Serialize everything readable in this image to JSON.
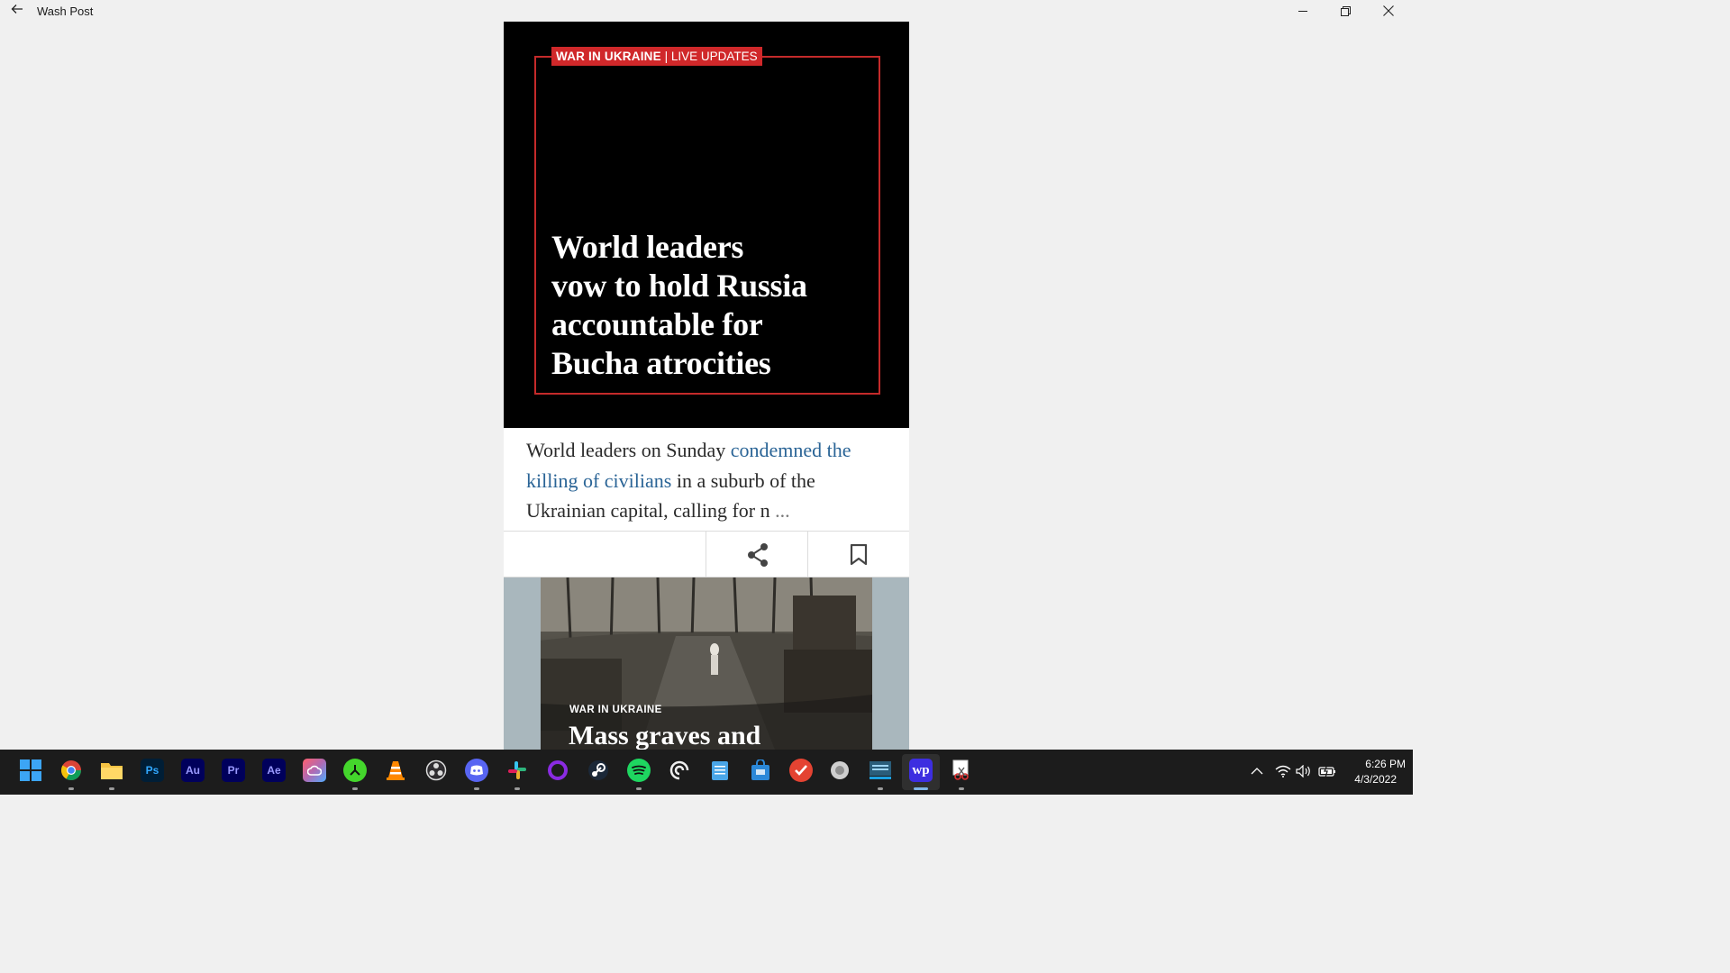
{
  "window": {
    "title": "Wash Post"
  },
  "hero": {
    "kicker_section": "WAR IN UKRAINE",
    "kicker_separator": "|",
    "kicker_label": "LIVE UPDATES",
    "headline_lines": [
      "World leaders",
      "vow to hold Russia",
      "accountable for",
      "Bucha atrocities"
    ]
  },
  "summary": {
    "text_before": "World leaders on Sunday ",
    "link_text": "condemned the killing of civilians",
    "text_after": " in a suburb of the Ukrainian capital, calling for n",
    "ellipsis": "..."
  },
  "next_story": {
    "kicker": "WAR IN UKRAINE",
    "headline": "Mass graves and"
  },
  "taskbar": {
    "apps": [
      {
        "name": "start-icon"
      },
      {
        "name": "chrome-icon"
      },
      {
        "name": "file-explorer-icon"
      },
      {
        "name": "photoshop-icon",
        "label": "Ps"
      },
      {
        "name": "audition-icon",
        "label": "Au"
      },
      {
        "name": "premiere-icon",
        "label": "Pr"
      },
      {
        "name": "after-effects-icon",
        "label": "Ae"
      },
      {
        "name": "creative-cloud-icon"
      },
      {
        "name": "razer-icon"
      },
      {
        "name": "vlc-icon"
      },
      {
        "name": "obs-icon"
      },
      {
        "name": "discord-icon"
      },
      {
        "name": "slack-icon"
      },
      {
        "name": "cortana-icon"
      },
      {
        "name": "steam-icon"
      },
      {
        "name": "spotify-icon"
      },
      {
        "name": "edge-icon"
      },
      {
        "name": "notepad-icon"
      },
      {
        "name": "store-icon"
      },
      {
        "name": "todoist-icon"
      },
      {
        "name": "settings-icon"
      },
      {
        "name": "app-icon"
      },
      {
        "name": "washington-post-icon",
        "label": "wp"
      },
      {
        "name": "snipping-tool-icon"
      }
    ],
    "clock": {
      "time": "6:26 PM",
      "date": "4/3/2022"
    }
  },
  "colors": {
    "kicker_red": "#d0282a",
    "link_blue": "#2a6496",
    "taskbar": "#1c1c1c"
  }
}
